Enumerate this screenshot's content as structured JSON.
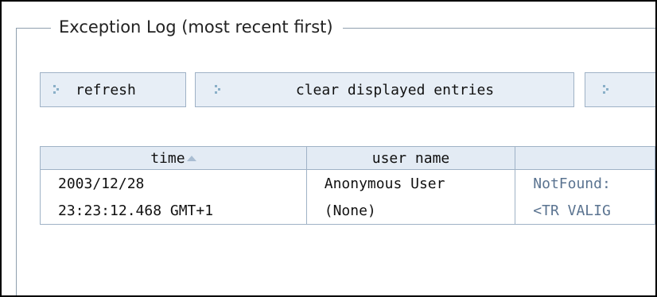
{
  "panel": {
    "legend": "Exception Log (most recent first)"
  },
  "buttons": {
    "refresh_label": "refresh",
    "clear_label": "clear displayed entries",
    "third_label": ""
  },
  "table": {
    "headers": [
      "time",
      "user name",
      ""
    ],
    "sort_indicator": "ascending-arrow",
    "rows": [
      [
        "2003/12/28",
        "Anonymous User",
        "NotFound:"
      ],
      [
        "23:23:12.468 GMT+1",
        "(None)",
        "<TR VALIG"
      ]
    ]
  },
  "colors": {
    "header_bg": "#e3ebf4",
    "border": "#9fb2c6",
    "button_bg": "#e7eef6",
    "message_text": "#5a7390"
  }
}
